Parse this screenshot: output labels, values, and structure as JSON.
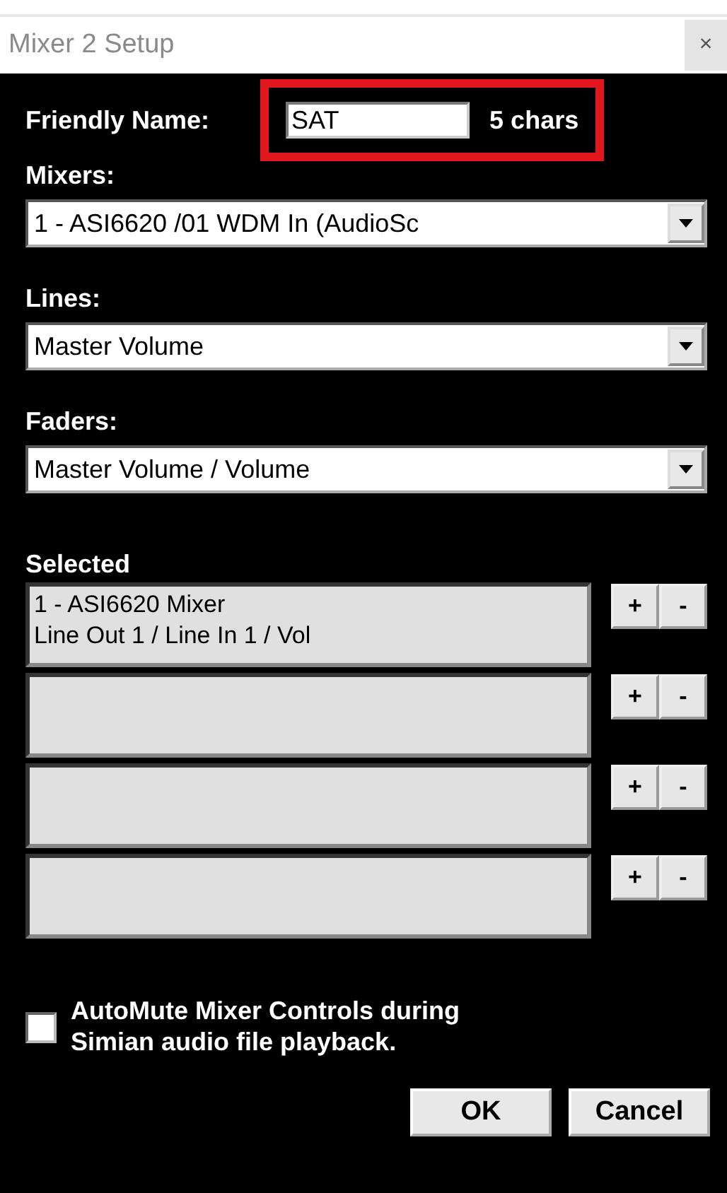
{
  "window": {
    "title": "Mixer 2 Setup",
    "close_label": "×"
  },
  "friendly_name": {
    "label": "Friendly Name:",
    "value": "SAT",
    "count": "5 chars",
    "highlighted": true
  },
  "dropdowns": [
    {
      "label": "Mixers:",
      "value": "1 - ASI6620 /01 WDM In (AudioSc"
    },
    {
      "label": "Lines:",
      "value": "Master Volume"
    },
    {
      "label": "Faders:",
      "value": "Master Volume / Volume"
    }
  ],
  "selected": {
    "label": "Selected",
    "slots": [
      {
        "lines": [
          "1 - ASI6620 Mixer",
          "Line Out 1 / Line In 1 / Vol"
        ],
        "add": "+",
        "remove": "-"
      },
      {
        "add": "+",
        "remove": "-"
      },
      {
        "add": "+",
        "remove": "-"
      },
      {
        "add": "+",
        "remove": "-"
      }
    ]
  },
  "automute": {
    "label": "AutoMute Mixer Controls during Simian audio file playback.",
    "checked": false
  },
  "buttons": [
    "OK",
    "Cancel"
  ]
}
